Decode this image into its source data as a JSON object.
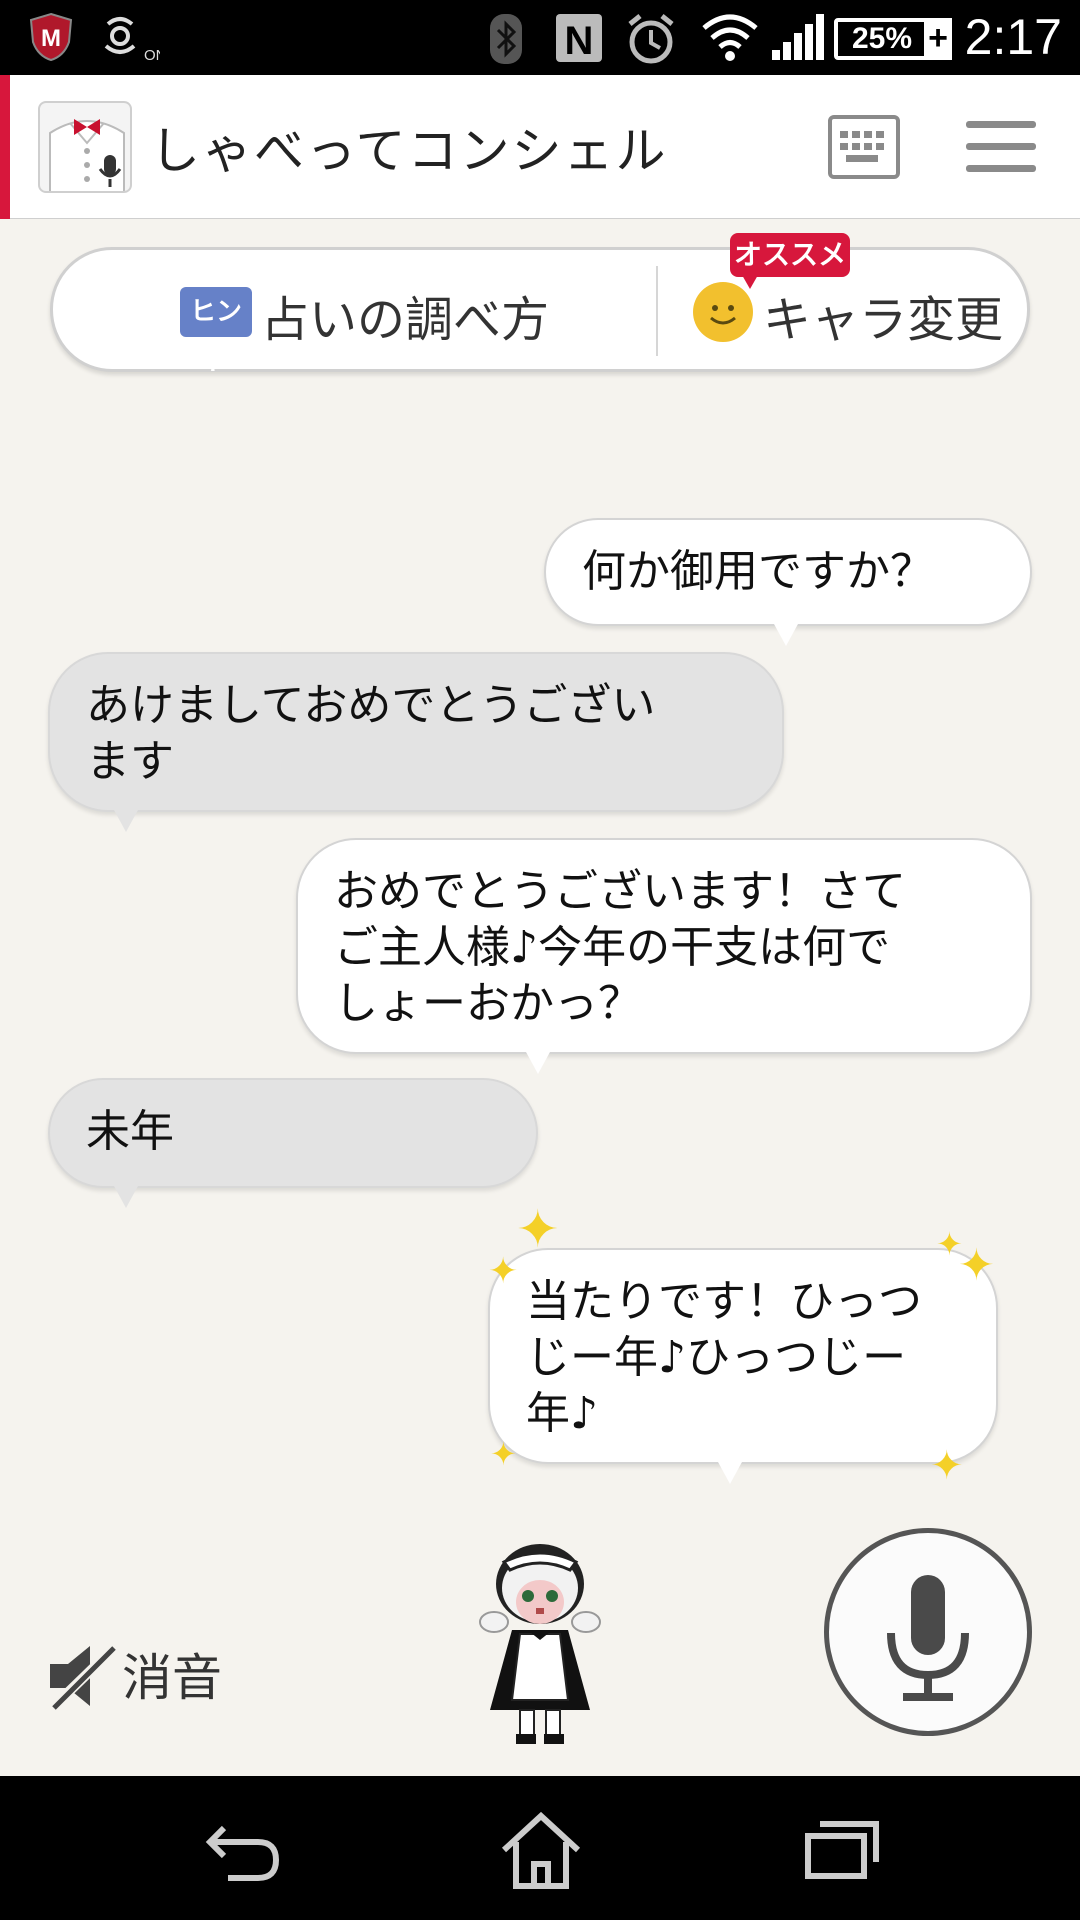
{
  "status_bar": {
    "time": "2:17",
    "battery_percent": "25%",
    "battery_plus": "+",
    "nfc_label": "N",
    "security_logo_letter": "M",
    "sync_label": "ON"
  },
  "app": {
    "title": "しゃべってコンシェル"
  },
  "hint_bar": {
    "hint_badge": "ヒント",
    "hint_label": "占いの調べ方",
    "recommend_tag": "オススメ",
    "character_label": "キャラ変更"
  },
  "messages": [
    {
      "speaker": "assistant",
      "text": "何か御用ですか？"
    },
    {
      "speaker": "user",
      "lines": [
        "あけましておめでとうござい",
        "ます"
      ]
    },
    {
      "speaker": "assistant",
      "lines": [
        "おめでとうございます！さて",
        "ご主人様♪今年の干支は何で",
        "しょーおかっ？"
      ]
    },
    {
      "speaker": "user",
      "text": "未年"
    },
    {
      "speaker": "assistant",
      "lines": [
        "当たりです！ひっつ",
        "じー年♪ひっつじー",
        "年♪"
      ]
    }
  ],
  "controls": {
    "mute_label": "消音"
  },
  "colors": {
    "accent_red": "#d7173c",
    "hint_blue": "#6681c8",
    "smiley_yellow": "#f2c02e",
    "sparkle_yellow": "#f4d028",
    "background": "#f5f3ee"
  },
  "icons": {
    "mute": "muted-speaker-icon",
    "mic": "microphone-icon",
    "keyboard": "keyboard-icon",
    "menu": "hamburger-menu-icon",
    "back": "back-icon",
    "home": "home-icon",
    "recents": "recent-apps-icon"
  }
}
